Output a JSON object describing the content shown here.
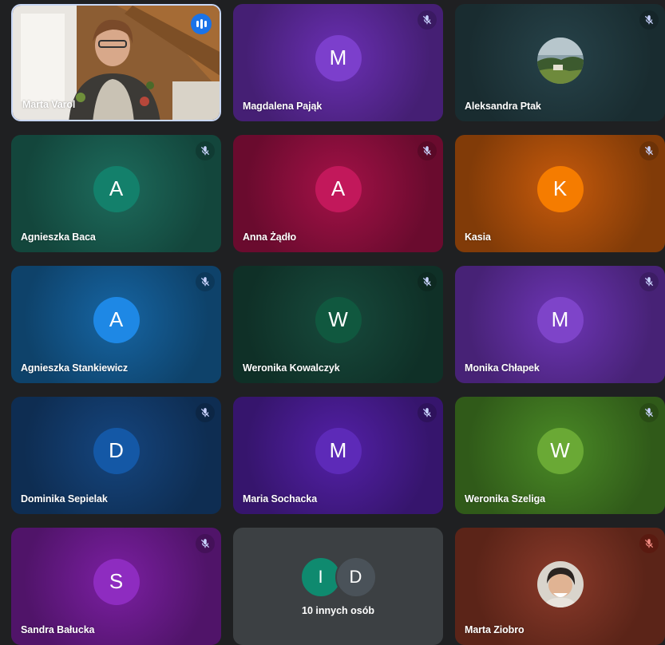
{
  "self_tile": {
    "name": "Marta Varol"
  },
  "tiles": [
    {
      "name": "Magdalena Pająk",
      "initial": "M",
      "bg": "#6a2fb3",
      "avatar": "#7c3fcc",
      "muted": true
    },
    {
      "name": "Aleksandra Ptak",
      "initial": "",
      "bg": "#27434a",
      "avatar": "",
      "muted": true,
      "photo": true
    },
    {
      "name": "Agnieszka Baca",
      "initial": "A",
      "bg": "#1d6b5c",
      "avatar": "#13806b",
      "muted": true
    },
    {
      "name": "Anna Żądło",
      "initial": "A",
      "bg": "#a31147",
      "avatar": "#c2185b",
      "muted": true
    },
    {
      "name": "Kasia",
      "initial": "K",
      "bg": "#c65a0c",
      "avatar": "#f57c00",
      "muted": true
    },
    {
      "name": "Agnieszka Stankiewicz",
      "initial": "A",
      "bg": "#1665a3",
      "avatar": "#1e88e5",
      "muted": true
    },
    {
      "name": "Weronika Kowalczyk",
      "initial": "W",
      "bg": "#174a3c",
      "avatar": "#10583f",
      "muted": true
    },
    {
      "name": "Monika Chłapek",
      "initial": "M",
      "bg": "#6d35b5",
      "avatar": "#7e44c9",
      "muted": true
    },
    {
      "name": "Dominika Sepielak",
      "initial": "D",
      "bg": "#15457e",
      "avatar": "#1458a6",
      "muted": true
    },
    {
      "name": "Maria Sochacka",
      "initial": "M",
      "bg": "#5320a7",
      "avatar": "#5d2ab8",
      "muted": true
    },
    {
      "name": "Weronika Szeliga",
      "initial": "W",
      "bg": "#4a8a26",
      "avatar": "#6aa935",
      "muted": true
    },
    {
      "name": "Sandra Bałucka",
      "initial": "S",
      "bg": "#7b1fa2",
      "avatar": "#8e2cc0",
      "muted": true
    }
  ],
  "others_tile": {
    "label": "10 innych osób",
    "bubbles": [
      {
        "initial": "I",
        "color": "#0f8a6f"
      },
      {
        "initial": "D",
        "color": "#4a5259"
      }
    ]
  },
  "last_tile": {
    "name": "Marta Ziobro",
    "bg": "#6b2a1c",
    "muted": true
  },
  "icons": {
    "mute": "mic-off-icon",
    "speaking": "audio-level-icon"
  }
}
